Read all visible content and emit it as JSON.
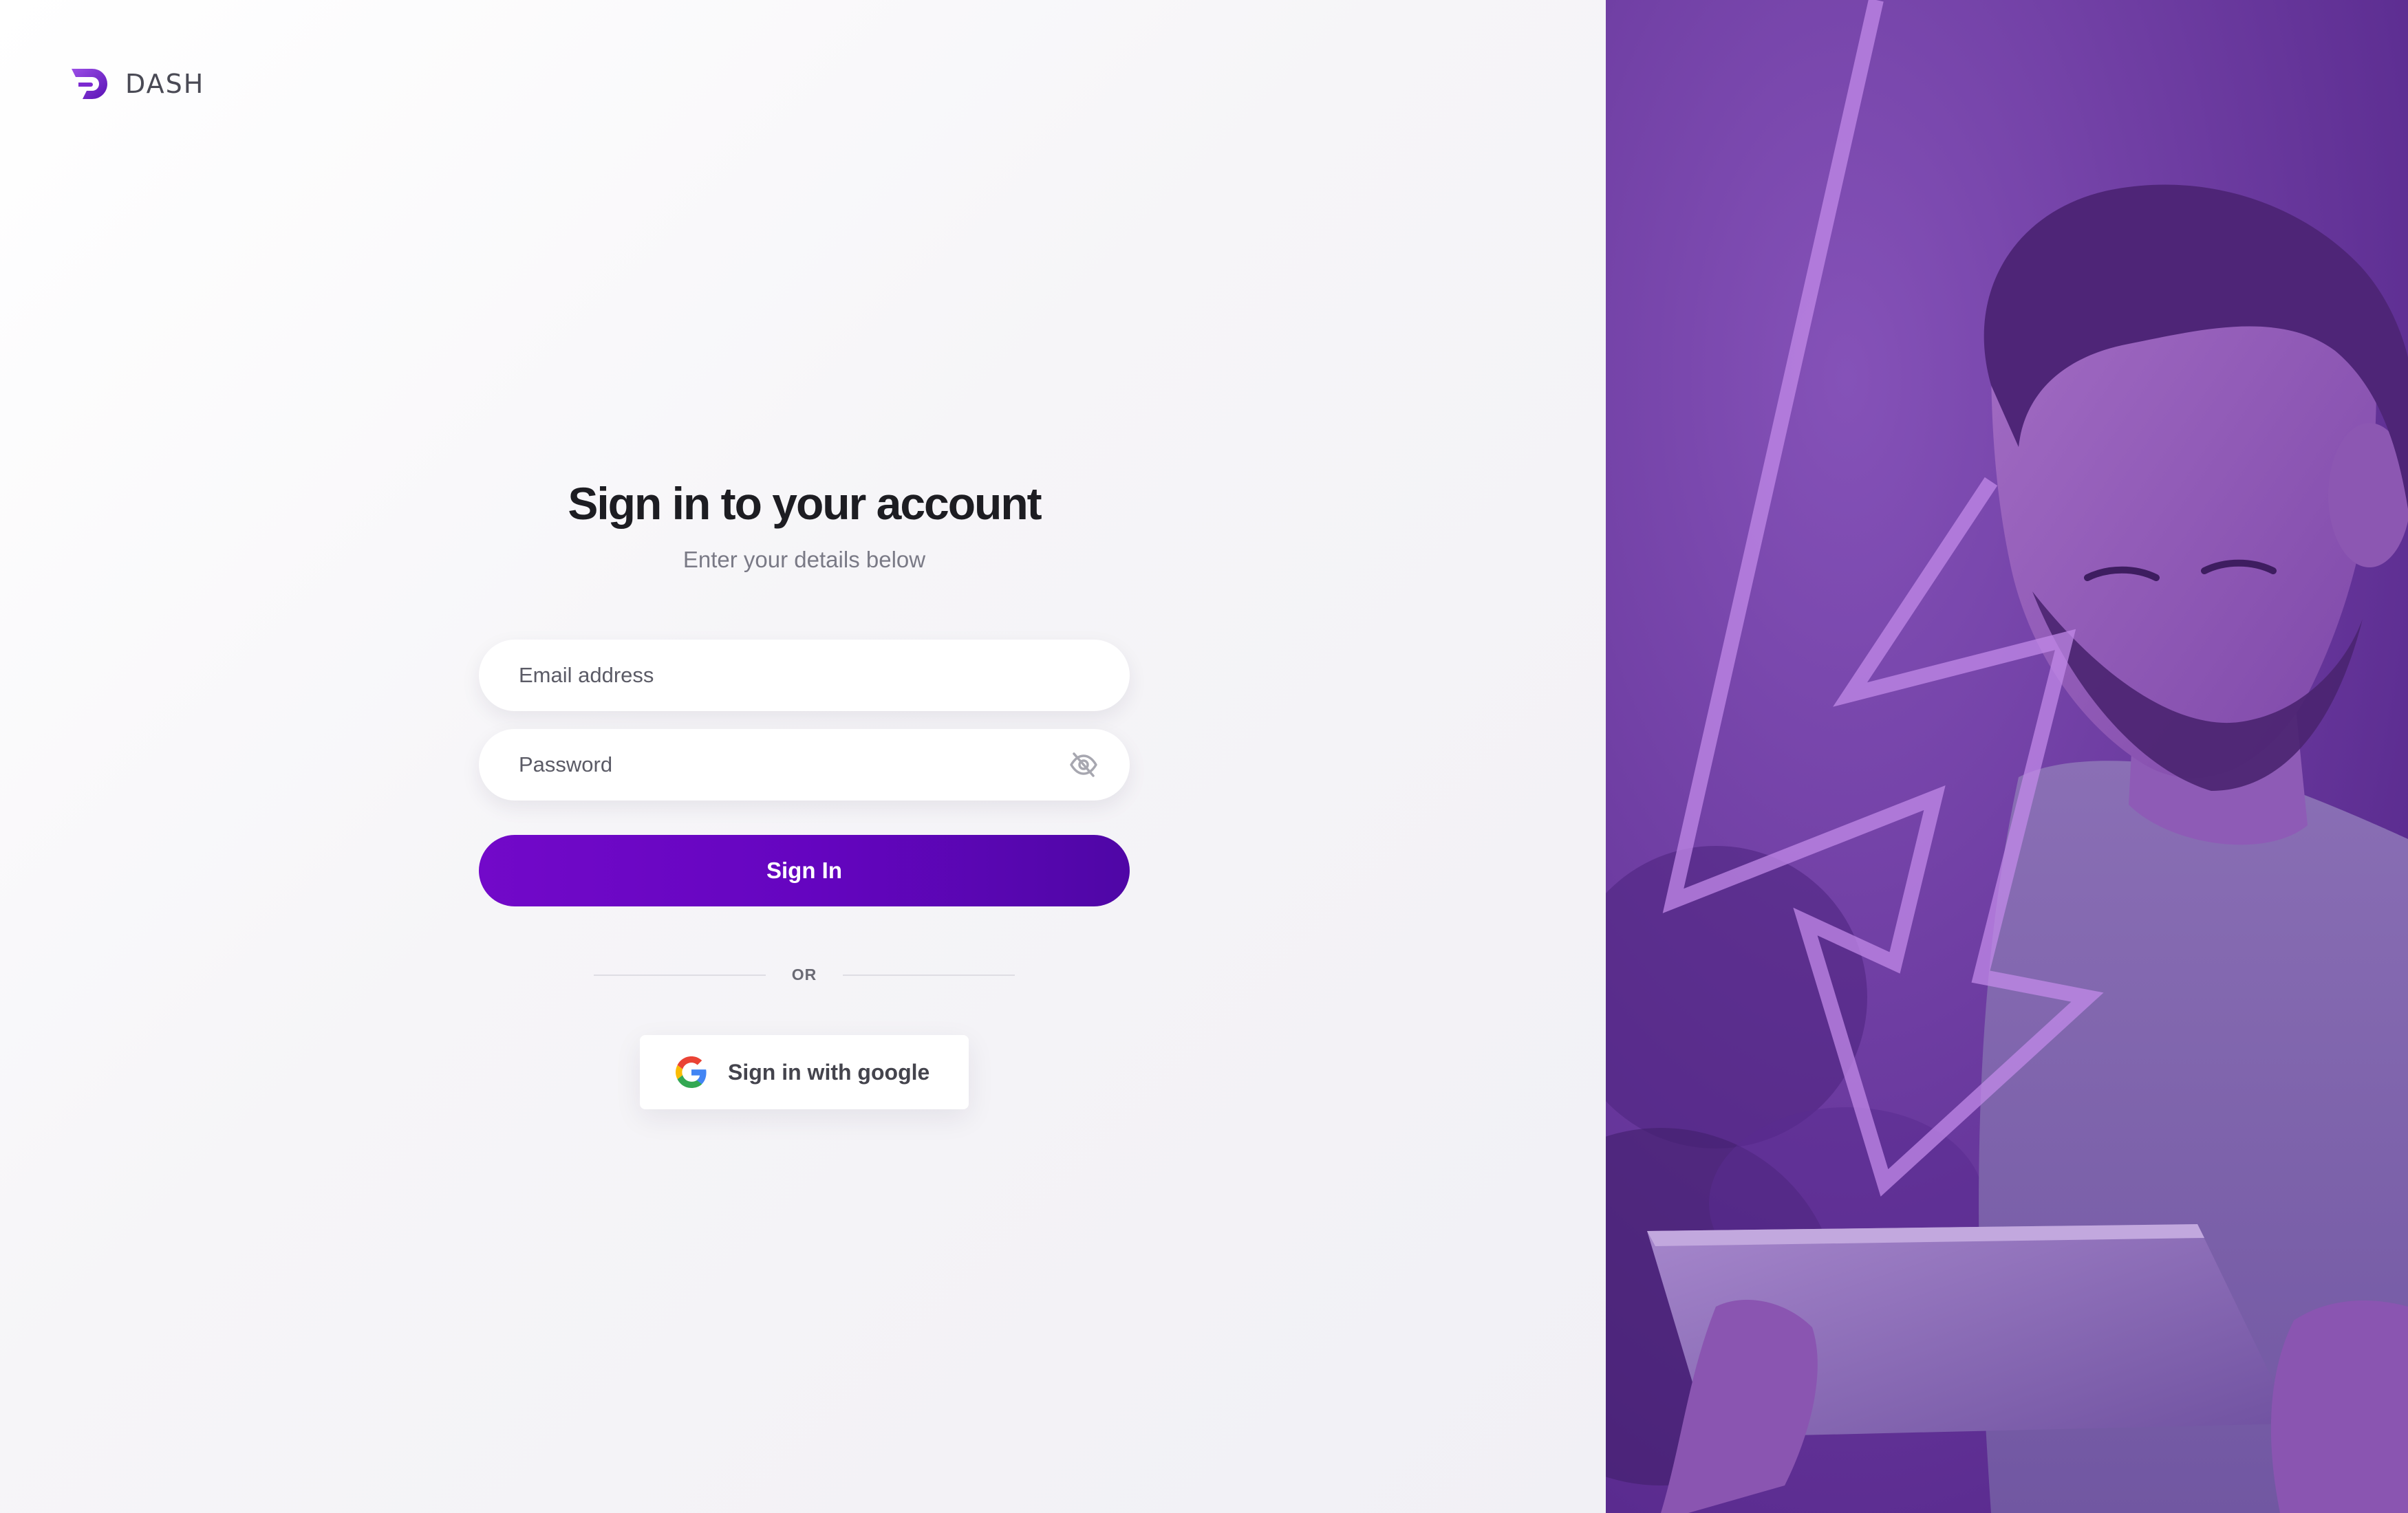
{
  "brand": {
    "name": "DASH",
    "icon": "dash-logo-icon",
    "color": "#7c2ad0"
  },
  "form": {
    "title": "Sign in to your account",
    "subtitle": "Enter your details below",
    "email_placeholder": "Email address",
    "email_value": "",
    "password_placeholder": "Password",
    "password_value": "",
    "password_toggle_icon": "eye-off-icon",
    "submit_label": "Sign In",
    "divider_label": "OR",
    "google_label": "Sign in with google",
    "google_icon": "google-icon"
  },
  "colors": {
    "accent_start": "#7209c9",
    "accent_end": "#4f06a6",
    "hero_overlay": "#6a3a9c"
  }
}
